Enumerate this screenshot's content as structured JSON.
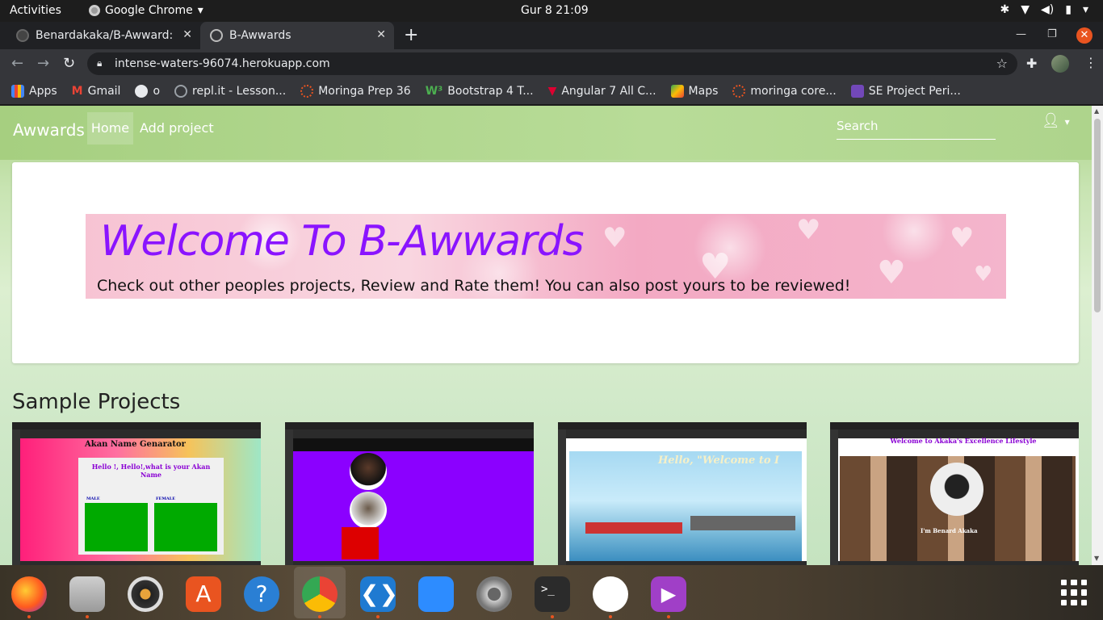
{
  "system": {
    "activities": "Activities",
    "app_name": "Google Chrome",
    "clock": "Gur 8  21:09"
  },
  "tabs": [
    {
      "label": "Benardakaka/B-Awward:",
      "active": false
    },
    {
      "label": "B-Awwards",
      "active": true
    }
  ],
  "address": {
    "url": "intense-waters-96074.herokuapp.com"
  },
  "bookmarks": [
    {
      "label": "Apps",
      "icon": "apps-grid-icon"
    },
    {
      "label": "Gmail",
      "icon": "gmail-icon"
    },
    {
      "label": "o",
      "icon": "github-icon"
    },
    {
      "label": "repl.it - Lesson...",
      "icon": "replit-icon"
    },
    {
      "label": "Moringa Prep 36",
      "icon": "moringa-icon"
    },
    {
      "label": "Bootstrap 4 T...",
      "icon": "w3schools-icon"
    },
    {
      "label": "Angular 7 All C...",
      "icon": "angular-icon"
    },
    {
      "label": "Maps",
      "icon": "maps-icon"
    },
    {
      "label": "moringa core...",
      "icon": "moringa-icon"
    },
    {
      "label": "SE Project Peri...",
      "icon": "forms-icon"
    }
  ],
  "site": {
    "brand": "Awwards",
    "nav": {
      "home": "Home",
      "add": "Add project"
    },
    "search_placeholder": "Search",
    "hero": {
      "title": "Welcome To B-Awwards",
      "subtitle": "Check out other peoples projects, Review and Rate them! You can also post yours to be reviewed!"
    },
    "section_title": "Sample Projects",
    "projects": [
      {
        "heading": "Akan Name Genarator",
        "sub": "Hello !, Hello!,what is your Akan Name",
        "col_a": "MALE",
        "col_b": "FEMALE"
      },
      {
        "heading": "",
        "sub": ""
      },
      {
        "heading": "Hello, \"Welcome to I",
        "sub": ""
      },
      {
        "heading": "Welcome to Akaka's Excellence Lifestyle",
        "sub": "I'm Benard Akaka"
      }
    ]
  },
  "colors": {
    "accent_purple": "#8a14ff",
    "navbar_green": "#a6cf80",
    "ubuntu_orange": "#e95420"
  }
}
